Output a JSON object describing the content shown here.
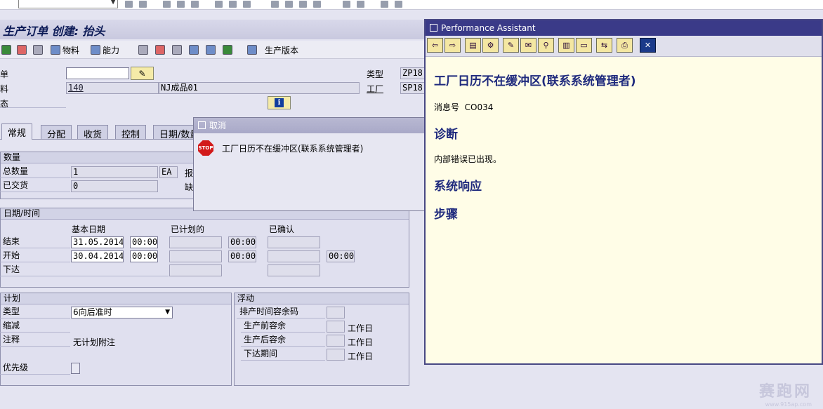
{
  "toolbar": {
    "command_field": ""
  },
  "title": "生产订单 创建: 抬头",
  "app_toolbar": {
    "material_label": "物料",
    "capacity_label": "能力",
    "prod_version_label": "生产版本"
  },
  "header": {
    "order_label": "单",
    "order_value": "",
    "material_label": "料",
    "material_value": "140",
    "material_desc": "NJ成品01",
    "status_label": "态",
    "type_label": "类型",
    "type_value": "ZP18",
    "plant_label": "工厂",
    "plant_value": "SP18"
  },
  "tabs": [
    "常规",
    "分配",
    "收货",
    "控制",
    "日期/数量"
  ],
  "quantity": {
    "group_title": "数量",
    "total_label": "总数量",
    "total_value": "1",
    "unit": "EA",
    "delivered_label": "已交货",
    "delivered_value": "0",
    "side_label_1": "报",
    "side_label_2": "缺"
  },
  "dates": {
    "group_title": "日期/时间",
    "col_basic": "基本日期",
    "col_scheduled": "已计划的",
    "col_confirmed": "已确认",
    "end_label": "结束",
    "end_date": "31.05.2014",
    "end_time": "00:00",
    "end_sched_time": "00:00",
    "start_label": "开始",
    "start_date": "30.04.2014",
    "start_time": "00:00",
    "start_sched_time": "00:00",
    "start_conf_time": "00:00",
    "release_label": "下达"
  },
  "planning": {
    "group_title": "计划",
    "type_label": "类型",
    "type_value": "6向后准时",
    "reduce_label": "缩减",
    "note_label": "注释",
    "note_value": "无计划附注",
    "priority_label": "优先级"
  },
  "float": {
    "group_title": "浮动",
    "sched_margin_label": "排产时间容余码",
    "before_label": "生产前容余",
    "after_label": "生产后容余",
    "release_label": "下达期间",
    "unit": "工作日"
  },
  "cancel_dialog": {
    "title": "取消",
    "message": "工厂日历不在缓冲区(联系系统管理者)"
  },
  "perf_assistant": {
    "title": "Performance Assistant",
    "heading": "工厂日历不在缓冲区(联系系统管理者)",
    "msg_no_label": "消息号",
    "msg_no_value": "CO034",
    "diagnosis_heading": "诊断",
    "diagnosis_text": "内部错误已出现。",
    "response_heading": "系统响应",
    "steps_heading": "步骤"
  },
  "watermark": {
    "text": "赛跑网",
    "url": "www.915ap.com"
  }
}
